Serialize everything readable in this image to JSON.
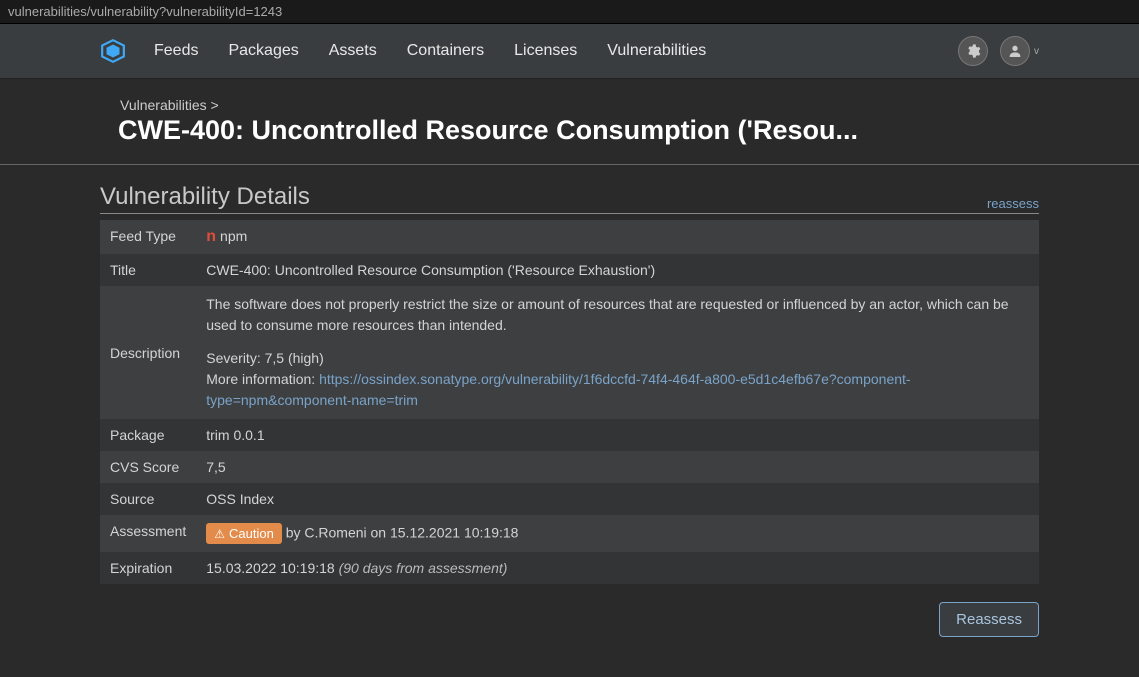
{
  "url": "vulnerabilities/vulnerability?vulnerabilityId=1243",
  "nav": {
    "items": [
      "Feeds",
      "Packages",
      "Assets",
      "Containers",
      "Licenses",
      "Vulnerabilities"
    ],
    "user_chev": "v"
  },
  "breadcrumb": "Vulnerabilities >",
  "page_title": "CWE-400: Uncontrolled Resource Consumption ('Resou...",
  "section": {
    "title": "Vulnerability Details",
    "reassess_link": "reassess"
  },
  "details": {
    "feed_type_label": "Feed Type",
    "feed_type_value": "npm",
    "title_label": "Title",
    "title_value": "CWE-400: Uncontrolled Resource Consumption ('Resource Exhaustion')",
    "description_label": "Description",
    "description_text": "The software does not properly restrict the size or amount of resources that are requested or influenced by an actor, which can be used to consume more resources than intended.",
    "severity_line": "Severity: 7,5 (high)",
    "more_info_prefix": "More information: ",
    "more_info_link": "https://ossindex.sonatype.org/vulnerability/1f6dccfd-74f4-464f-a800-e5d1c4efb67e?component-type=npm&component-name=trim",
    "package_label": "Package",
    "package_value": "trim 0.0.1",
    "cvs_label": "CVS Score",
    "cvs_value": "7,5",
    "source_label": "Source",
    "source_value": "OSS Index",
    "assessment_label": "Assessment",
    "assessment_badge": "Caution",
    "assessment_by": " by C.Romeni on 15.12.2021 10:19:18",
    "expiration_label": "Expiration",
    "expiration_value": "15.03.2022 10:19:18 ",
    "expiration_note": "(90 days from assessment)"
  },
  "button": "Reassess"
}
